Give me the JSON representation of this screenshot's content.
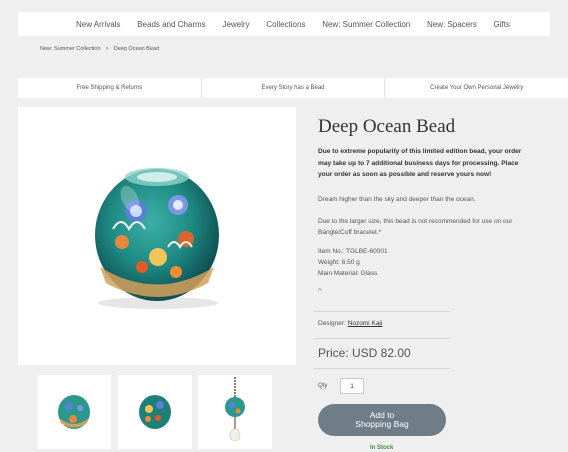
{
  "nav": {
    "items": [
      "New Arrivals",
      "Beads and Charms",
      "Jewelry",
      "Collections",
      "New: Summer Collection",
      "New: Spacers",
      "Gifts"
    ]
  },
  "breadcrumb": {
    "items": [
      "New: Summer Collection",
      "Deep Ocean Bead"
    ],
    "separator": ">"
  },
  "promo": {
    "items": [
      "Free Shipping & Returns",
      "Every Story has a Bead",
      "Create Your Own Personal Jewelry"
    ]
  },
  "product": {
    "title": "Deep Ocean Bead",
    "notice": "Due to extreme popularity of this limited edition bead, your order may take up to 7 additional business days for processing. Place your order as soon as possible and reserve yours now!",
    "tagline": "Dream higher than the sky and deeper than the ocean.",
    "note": "Due to the larger size, this bead is not recommended for use on our Bangle/Cuff bracelet.*",
    "item_no": "Item No.: TGLBE-60001",
    "weight": "Weight: 6.50 g",
    "material": "Main Material: Glass",
    "collapse_glyph": "^",
    "designer_label": "Designer:",
    "designer_name": "Nozomi Kaji",
    "price": "Price: USD 82.00",
    "qty_label": "Qty",
    "qty_value": "1",
    "cart_line1": "Add to",
    "cart_line2": "Shopping Bag",
    "stock": "In Stock"
  },
  "colors": {
    "accent_button": "#6f7d88",
    "in_stock": "#3c8f3c"
  }
}
